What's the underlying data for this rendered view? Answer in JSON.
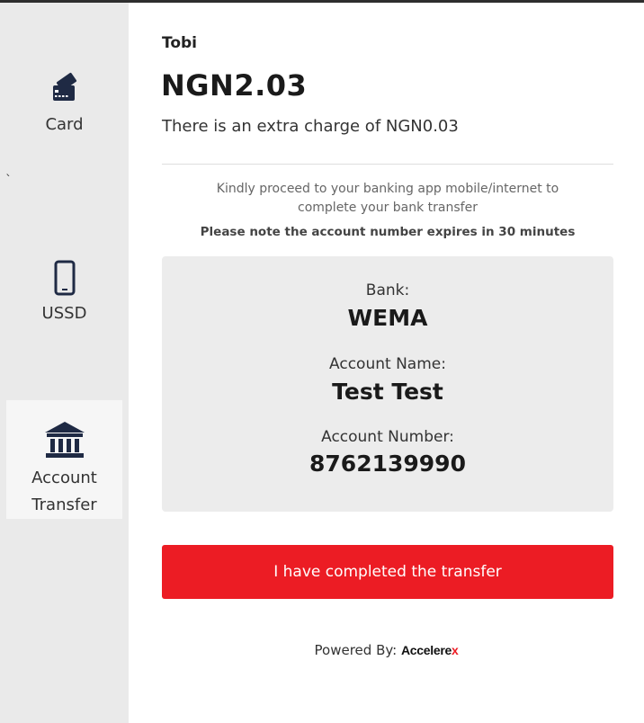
{
  "sidebar": {
    "items": [
      {
        "label": "Card",
        "icon": "credit-card-icon"
      },
      {
        "label": "USSD",
        "icon": "mobile-phone-icon"
      },
      {
        "label_line1": "Account",
        "label_line2": "Transfer",
        "icon": "bank-icon",
        "active": true
      }
    ],
    "stray_mark": "`"
  },
  "payment": {
    "merchant": "Tobi",
    "amount": "NGN2.03",
    "charge_text": "There is an extra charge of NGN0.03"
  },
  "instructions": {
    "line1": "Kindly proceed to your banking app mobile/internet to",
    "line2": "complete your bank transfer",
    "note": "Please note the account number expires in 30 minutes"
  },
  "bank_details": {
    "bank_label": "Bank:",
    "bank_value": "WEMA",
    "account_name_label": "Account Name:",
    "account_name_value": "Test Test",
    "account_number_label": "Account Number:",
    "account_number_value": "8762139990"
  },
  "actions": {
    "complete_label": "I have completed the transfer"
  },
  "footer": {
    "powered_by": "Powered By:",
    "brand": "Accelere",
    "brand_suffix": "x"
  },
  "colors": {
    "accent": "#ec1c24",
    "sidebar_bg": "#eaeaea",
    "box_bg": "#ececec",
    "icon": "#1f2a44"
  }
}
